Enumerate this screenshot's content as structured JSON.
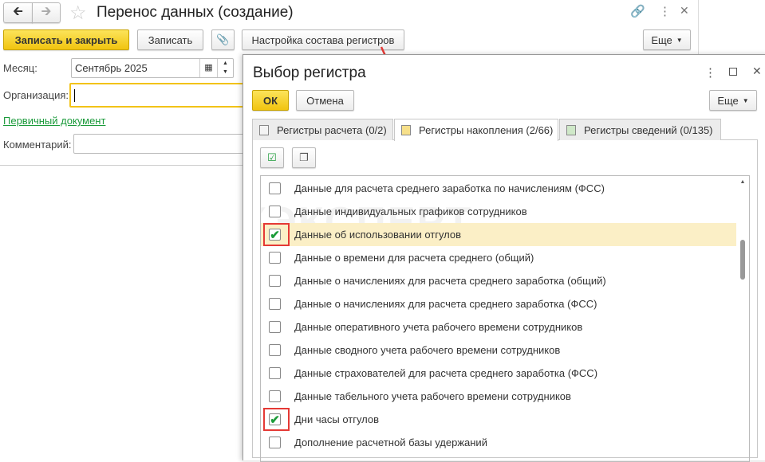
{
  "window": {
    "title": "Перенос данных (создание)"
  },
  "toolbar": {
    "save_close": "Записать и закрыть",
    "save": "Записать",
    "settings": "Настройка состава регистров",
    "more": "Еще"
  },
  "form": {
    "month_label": "Месяц:",
    "month_value": "Сентябрь 2025",
    "org_label": "Организация:",
    "org_value": "",
    "primary_doc_link": "Первичный документ",
    "comment_label": "Комментарий:",
    "comment_value": ""
  },
  "dialog": {
    "title": "Выбор регистра",
    "ok": "ОК",
    "cancel": "Отмена",
    "more": "Еще",
    "tabs": [
      {
        "label": "Регистры расчета (0/2)"
      },
      {
        "label": "Регистры накопления (2/66)"
      },
      {
        "label": "Регистры сведений (0/135)"
      }
    ],
    "items": [
      {
        "label": "Данные для расчета среднего заработка по начислениям (ФСС)",
        "checked": false
      },
      {
        "label": "Данные индивидуальных графиков сотрудников",
        "checked": false
      },
      {
        "label": "Данные об использовании отгулов",
        "checked": true
      },
      {
        "label": "Данные о времени для расчета среднего (общий)",
        "checked": false
      },
      {
        "label": "Данные о начислениях для расчета среднего заработка (общий)",
        "checked": false
      },
      {
        "label": "Данные о начислениях для расчета среднего заработка (ФСС)",
        "checked": false
      },
      {
        "label": "Данные оперативного учета рабочего времени сотрудников",
        "checked": false
      },
      {
        "label": "Данные сводного учета рабочего времени сотрудников",
        "checked": false
      },
      {
        "label": "Данные страхователей для расчета среднего заработка (ФСС)",
        "checked": false
      },
      {
        "label": "Данные табельного учета рабочего времени сотрудников",
        "checked": false
      },
      {
        "label": "Дни часы отгулов",
        "checked": true
      },
      {
        "label": "Дополнение расчетной базы удержаний",
        "checked": false
      }
    ]
  },
  "watermark": "БУХЭКСПЕРТ"
}
